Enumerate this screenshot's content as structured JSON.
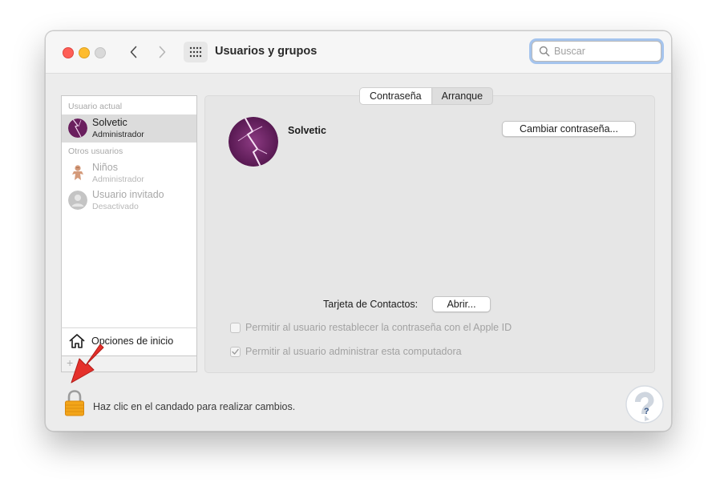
{
  "window": {
    "title": "Usuarios y grupos",
    "search_placeholder": "Buscar"
  },
  "sidebar": {
    "current_section": "Usuario actual",
    "current_user": {
      "name": "Solvetic",
      "role": "Administrador"
    },
    "other_section": "Otros usuarios",
    "other_users": [
      {
        "name": "Niños",
        "role": "Administrador"
      },
      {
        "name": "Usuario invitado",
        "role": "Desactivado"
      }
    ],
    "login_options": "Opciones de inicio",
    "add_symbol": "+"
  },
  "main": {
    "tabs": [
      {
        "label": "Contraseña",
        "active": true
      },
      {
        "label": "Arranque",
        "active": false
      }
    ],
    "user_name": "Solvetic",
    "change_password_button": "Cambiar contraseña...",
    "contacts_label": "Tarjeta de Contactos:",
    "open_button": "Abrir...",
    "checkboxes": [
      {
        "label": "Permitir al usuario restablecer la contraseña con el Apple ID",
        "checked": false
      },
      {
        "label": "Permitir al usuario administrar esta computadora",
        "checked": true
      }
    ]
  },
  "footer": {
    "lock_text": "Haz clic en el candado para realizar cambios."
  },
  "colors": {
    "accent_focus": "#a5c4ed",
    "close": "#fe5f57",
    "minimize": "#febc2e",
    "arrow": "#e5302b",
    "lock": "#f2a51a"
  }
}
